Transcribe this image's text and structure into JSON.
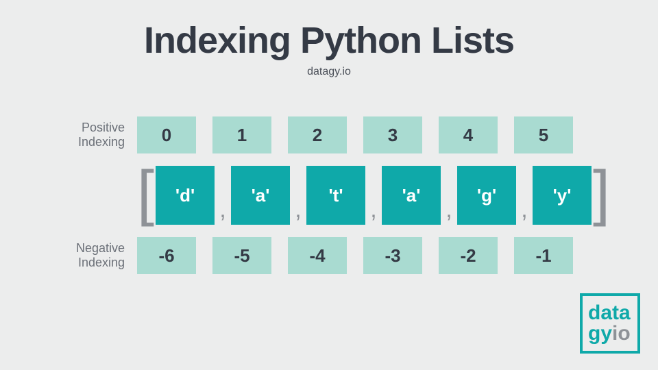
{
  "title": "Indexing Python Lists",
  "subtitle": "datagy.io",
  "labels": {
    "positive": "Positive Indexing",
    "negative": "Negative Indexing"
  },
  "positive_indices": [
    "0",
    "1",
    "2",
    "3",
    "4",
    "5"
  ],
  "negative_indices": [
    "-6",
    "-5",
    "-4",
    "-3",
    "-2",
    "-1"
  ],
  "elements": [
    "'d'",
    "'a'",
    "'t'",
    "'a'",
    "'g'",
    "'y'"
  ],
  "brackets": {
    "left": "[",
    "right": "]"
  },
  "comma": ",",
  "logo": {
    "line1": "data",
    "gy": "gy",
    "io": "io"
  },
  "colors": {
    "teal": "#0fa9a9",
    "mint": "#a9dbd1",
    "dark": "#343a45",
    "gray": "#8e9297"
  },
  "chart_data": {
    "type": "table",
    "title": "Indexing Python Lists",
    "categories": [
      "'d'",
      "'a'",
      "'t'",
      "'a'",
      "'g'",
      "'y'"
    ],
    "series": [
      {
        "name": "Positive Indexing",
        "values": [
          0,
          1,
          2,
          3,
          4,
          5
        ]
      },
      {
        "name": "Negative Indexing",
        "values": [
          -6,
          -5,
          -4,
          -3,
          -2,
          -1
        ]
      }
    ]
  }
}
